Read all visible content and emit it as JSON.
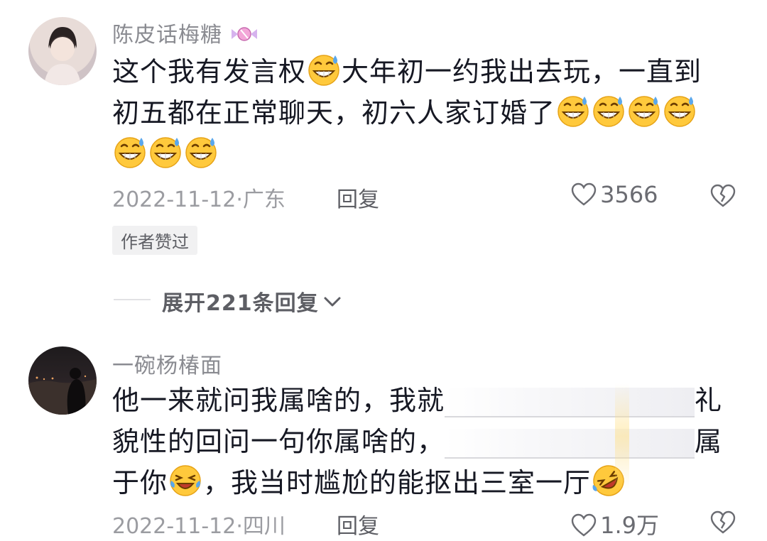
{
  "comments": [
    {
      "username": "陈皮话梅糖",
      "text_line1_a": "这个我有发言权",
      "text_line1_b": "大年初一约我出去玩，一直到",
      "text_line2": "初五都在正常聊天，初六人家订婚了",
      "date_location": "2022-11-12·广东",
      "reply_label": "回复",
      "like_count": "3566",
      "author_badge": "作者赞过"
    },
    {
      "username": "一碗杨椿面",
      "text_line1_a": "他一来就问我属啥的，我就",
      "text_line1_b": "礼",
      "text_line2_a": "貌性的回问一句你属啥的，",
      "text_line2_b": "属",
      "text_line3_a": "于你",
      "text_line3_b": "，我当时尴尬的能抠出三室一厅",
      "date_location": "2022-11-12·四川",
      "reply_label": "回复",
      "like_count": "1.9万"
    }
  ],
  "expand_replies_label": "展开221条回复",
  "icons": {
    "heart": "heart-outline-icon",
    "dislike": "broken-heart-icon",
    "sweat_smile": "grinning-sweat-emoji",
    "crying_laugh": "rolling-laughing-emoji",
    "candy": "candy-icon",
    "chevron": "chevron-down-icon"
  },
  "colors": {
    "primary_text": "#161823",
    "secondary_text": "#8a8b91",
    "emoji_yellow": "#ffc93c"
  }
}
